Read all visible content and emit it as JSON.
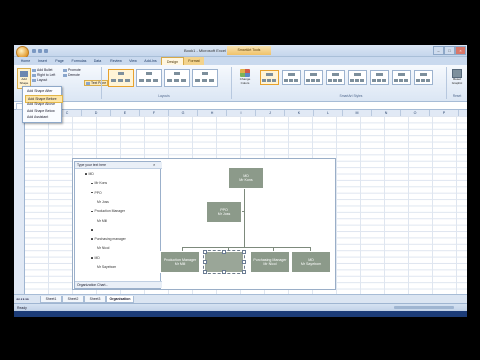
{
  "window": {
    "title": "Book1 - Microsoft Excel",
    "context_title": "SmartArt Tools"
  },
  "ribbon": {
    "tabs": [
      "Home",
      "Insert",
      "Page Layout",
      "Formulas",
      "Data",
      "Review",
      "View",
      "Add-Ins",
      "Design",
      "Format"
    ],
    "selected_tab": "Design",
    "create_graphic": {
      "add_shape": "Add Shape",
      "items": [
        "Add Bullet",
        "Right to Left",
        "Layout"
      ],
      "items2": [
        "Promote",
        "Demote"
      ],
      "text_pane": "Text Pane"
    },
    "groups": [
      "Layouts",
      "SmartArt Styles"
    ],
    "change_colors": "Change Colors",
    "reset_graphic": "Reset Graphic",
    "reset_group": "Reset"
  },
  "menu": {
    "items": [
      "Add Shape After",
      "Add Shape Before",
      "Add Shape Above",
      "Add Shape Below",
      "Add Assistant"
    ],
    "highlighted_index": 1
  },
  "columns": [
    "B",
    "C",
    "D",
    "E",
    "F",
    "G",
    "H",
    "I",
    "J",
    "K",
    "L",
    "M",
    "N",
    "O",
    "P"
  ],
  "text_pane": {
    "title": "Type your text here",
    "footer": "Organization Chart...",
    "entries": [
      {
        "text": "MD",
        "indent": 0
      },
      {
        "text": "Mr Kons",
        "indent": 1
      },
      {
        "text": "PPO",
        "indent": 1
      },
      {
        "text": "Mr Joss",
        "indent": 2
      },
      {
        "text": "Production Manager",
        "indent": 1
      },
      {
        "text": "Mr Mill",
        "indent": 2
      },
      {
        "text": "",
        "indent": 1
      },
      {
        "text": "Purchasing manager",
        "indent": 1
      },
      {
        "text": "Mr Nicol",
        "indent": 2
      },
      {
        "text": "MD",
        "indent": 1
      },
      {
        "text": "Mr Sayebom",
        "indent": 2
      }
    ]
  },
  "chart": {
    "top": {
      "line1": "MD",
      "line2": "Mr Kons"
    },
    "assistant": {
      "line1": "PPO",
      "line2": "Mr Joss"
    },
    "children": [
      {
        "line1": "Production Manager",
        "line2": "Mr Mill"
      },
      {
        "line1": "",
        "line2": ""
      },
      {
        "line1": "Purchasing Manager",
        "line2": "Mr Nicol"
      },
      {
        "line1": "MD",
        "line2": "Mr Sayebom"
      }
    ]
  },
  "sheets": [
    "Sheet1",
    "Sheet2",
    "Sheet3",
    "Organisation"
  ],
  "selected_sheet": "Organisation",
  "status": "Ready",
  "colors": {
    "box": "#8c9a8a",
    "context_tab": "#f3d38c",
    "highlight": "#fde6a8"
  }
}
